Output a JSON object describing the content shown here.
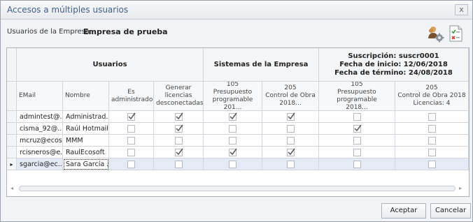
{
  "dialog": {
    "title": "Accesos a múltiples usuarios",
    "close_glyph": "x"
  },
  "company": {
    "label": "Usuarios de la Empresa:",
    "value": "Empresa de prueba"
  },
  "toolbar": {
    "icons": [
      "users-settings-icon",
      "checklist-icon"
    ]
  },
  "grid": {
    "bands": {
      "usuarios": "Usuarios",
      "sistemas": "Sistemas de la Empresa",
      "suscripcion": [
        "Suscripción: suscr0001",
        "Fecha de inicio: 12/06/2018",
        "Fecha de término: 24/08/2018"
      ]
    },
    "columns": [
      [
        "EMail"
      ],
      [
        "Nombre"
      ],
      [
        "Es",
        "administrador"
      ],
      [
        "Generar",
        "licencias",
        "desconectadas"
      ],
      [
        "105",
        "Presupuesto",
        "programable 201..."
      ],
      [
        "205",
        "Control de Obra",
        "2018..."
      ],
      [
        "105",
        "Presupuesto programable",
        "2018..."
      ],
      [
        "205",
        "Control de Obra 2018",
        "Licencias: 4"
      ]
    ],
    "rows": [
      {
        "email": "admintest@...",
        "nombre": "Administrad...",
        "checks": [
          true,
          true,
          true,
          true,
          false,
          false
        ]
      },
      {
        "email": "cisma_92@...",
        "nombre": "Raúl Hotmail",
        "checks": [
          false,
          true,
          false,
          false,
          true,
          false
        ]
      },
      {
        "email": "mcruz@ecos...",
        "nombre": "MMM",
        "checks": [
          false,
          false,
          false,
          false,
          false,
          false
        ]
      },
      {
        "email": "rcisneros@e...",
        "nombre": "RaulEcosoft",
        "checks": [
          false,
          true,
          true,
          true,
          false,
          false
        ]
      },
      {
        "email": "sgarcia@ec...",
        "nombre": "Sara García ...",
        "checks": [
          false,
          false,
          false,
          false,
          false,
          false
        ]
      }
    ],
    "current_row": 4,
    "current_row_indicator": "▸"
  },
  "scrollbar": {
    "left_glyph": "◂",
    "right_glyph": "▸"
  },
  "buttons": {
    "accept": "Aceptar",
    "cancel": "Cancelar"
  },
  "colors": {
    "title": "#3f5e86",
    "selected_row": "#e4ebf7",
    "check": "#555555"
  }
}
